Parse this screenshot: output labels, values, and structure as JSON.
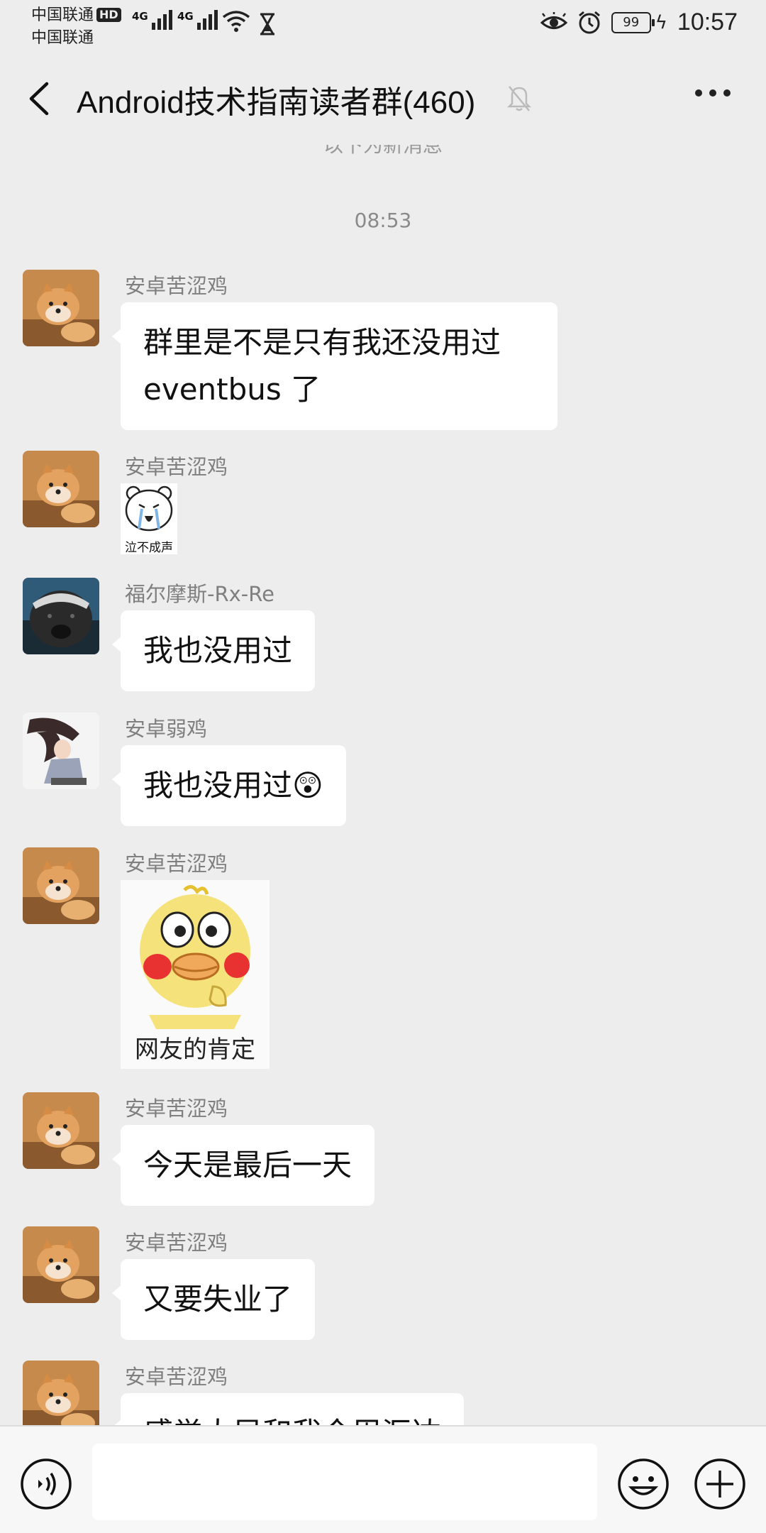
{
  "status_bar": {
    "carrier_1": "中国联通",
    "carrier_2": "中国联通",
    "hd_label": "HD",
    "network_1": "4G",
    "network_2": "4G",
    "battery": "99",
    "time": "10:57"
  },
  "header": {
    "title": "Android技术指南读者群(460)"
  },
  "chat": {
    "new_messages_divider": "以下为新消息",
    "timestamp": "08:53",
    "messages": [
      {
        "sender": "安卓苦涩鸡",
        "text": "群里是不是只有我还没用过eventbus 了",
        "avatar": "shiba-dog"
      },
      {
        "sender": "安卓苦涩鸡",
        "sticker_caption": "泣不成声",
        "avatar": "shiba-dog"
      },
      {
        "sender": "福尔摩斯-Rx-Re",
        "text": "我也没用过",
        "avatar": "honey-badger"
      },
      {
        "sender": "安卓弱鸡",
        "text": "我也没用过",
        "emoji": "😲",
        "avatar": "anime-character"
      },
      {
        "sender": "安卓苦涩鸡",
        "sticker_caption": "网友的肯定",
        "avatar": "shiba-dog"
      },
      {
        "sender": "安卓苦涩鸡",
        "text": "今天是最后一天",
        "avatar": "shiba-dog"
      },
      {
        "sender": "安卓苦涩鸡",
        "text": "又要失业了",
        "avatar": "shiba-dog"
      },
      {
        "sender": "安卓苦涩鸡",
        "text": "感觉大早和我今周汇达",
        "avatar": "shiba-dog"
      }
    ]
  },
  "input_bar": {
    "placeholder": ""
  },
  "colors": {
    "background": "#ededed",
    "bubble": "#ffffff",
    "sender_text": "#7f7f7f"
  }
}
